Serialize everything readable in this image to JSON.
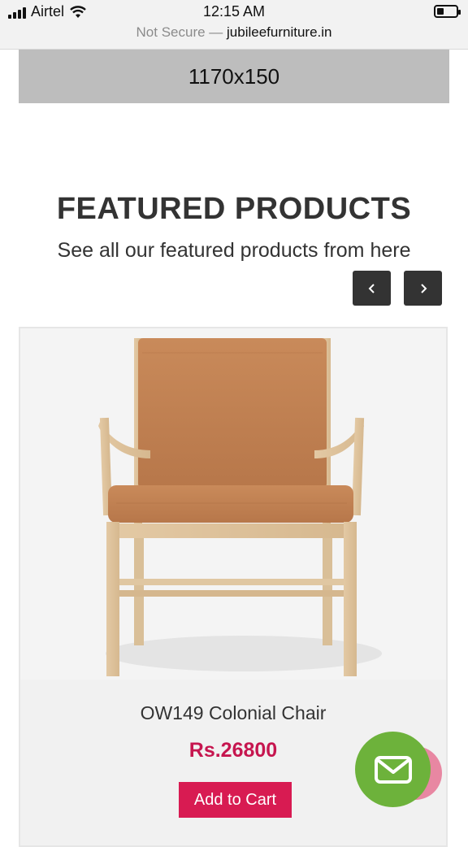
{
  "status_bar": {
    "carrier": "Airtel",
    "time": "12:15 AM",
    "battery_level": 0.35,
    "url_prefix": "Not Secure —",
    "url_domain": "jubileefurniture.in"
  },
  "banner": {
    "text": "1170x150"
  },
  "section": {
    "title": "FEATURED PRODUCTS",
    "subtitle": "See all our featured products from here"
  },
  "carousel": {
    "prev_icon": "chevron-left-icon",
    "next_icon": "chevron-right-icon"
  },
  "product": {
    "name": "OW149 Colonial Chair",
    "price": "Rs.26800",
    "add_to_cart_label": "Add to Cart",
    "image": "leather-armchair"
  },
  "chat_widget": {
    "icon": "mail-icon"
  },
  "colors": {
    "price": "#c6164f",
    "cart_button": "#d81b52",
    "fab": "#6db23b",
    "fab_secondary": "#e887a2",
    "nav_button": "#333333"
  }
}
